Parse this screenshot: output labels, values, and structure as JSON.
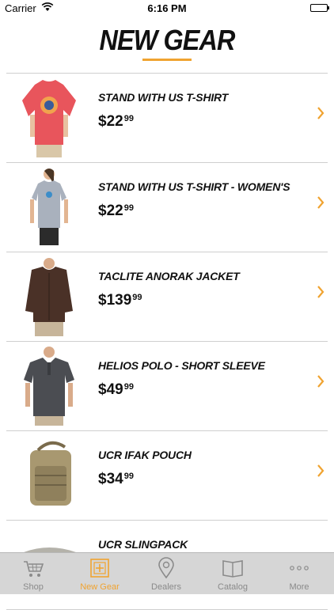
{
  "status_bar": {
    "carrier": "Carrier",
    "time": "6:16 PM"
  },
  "header": {
    "title": "NEW GEAR"
  },
  "colors": {
    "accent": "#f0a330",
    "tab_inactive": "#8a8a8a"
  },
  "products": [
    {
      "name": "STAND WITH US T-SHIRT",
      "price_dollars": "$22",
      "price_cents": "99",
      "image": "red-tshirt"
    },
    {
      "name": "STAND WITH US T-SHIRT - WOMEN'S",
      "price_dollars": "$22",
      "price_cents": "99",
      "image": "gray-womens-tshirt"
    },
    {
      "name": "TACLITE ANORAK JACKET",
      "price_dollars": "$139",
      "price_cents": "99",
      "image": "brown-jacket"
    },
    {
      "name": "HELIOS POLO - SHORT SLEEVE",
      "price_dollars": "$49",
      "price_cents": "99",
      "image": "gray-polo"
    },
    {
      "name": "UCR IFAK POUCH",
      "price_dollars": "$34",
      "price_cents": "99",
      "image": "tan-pouch"
    },
    {
      "name": "UCR SLINGPACK",
      "price_dollars": "",
      "price_cents": "",
      "image": "gray-slingpack"
    }
  ],
  "tab_bar": {
    "tabs": [
      {
        "label": "Shop",
        "icon": "cart-icon",
        "active": false
      },
      {
        "label": "New Gear",
        "icon": "new-gear-icon",
        "active": true
      },
      {
        "label": "Dealers",
        "icon": "location-pin-icon",
        "active": false
      },
      {
        "label": "Catalog",
        "icon": "book-icon",
        "active": false
      },
      {
        "label": "More",
        "icon": "more-dots-icon",
        "active": false
      }
    ]
  }
}
